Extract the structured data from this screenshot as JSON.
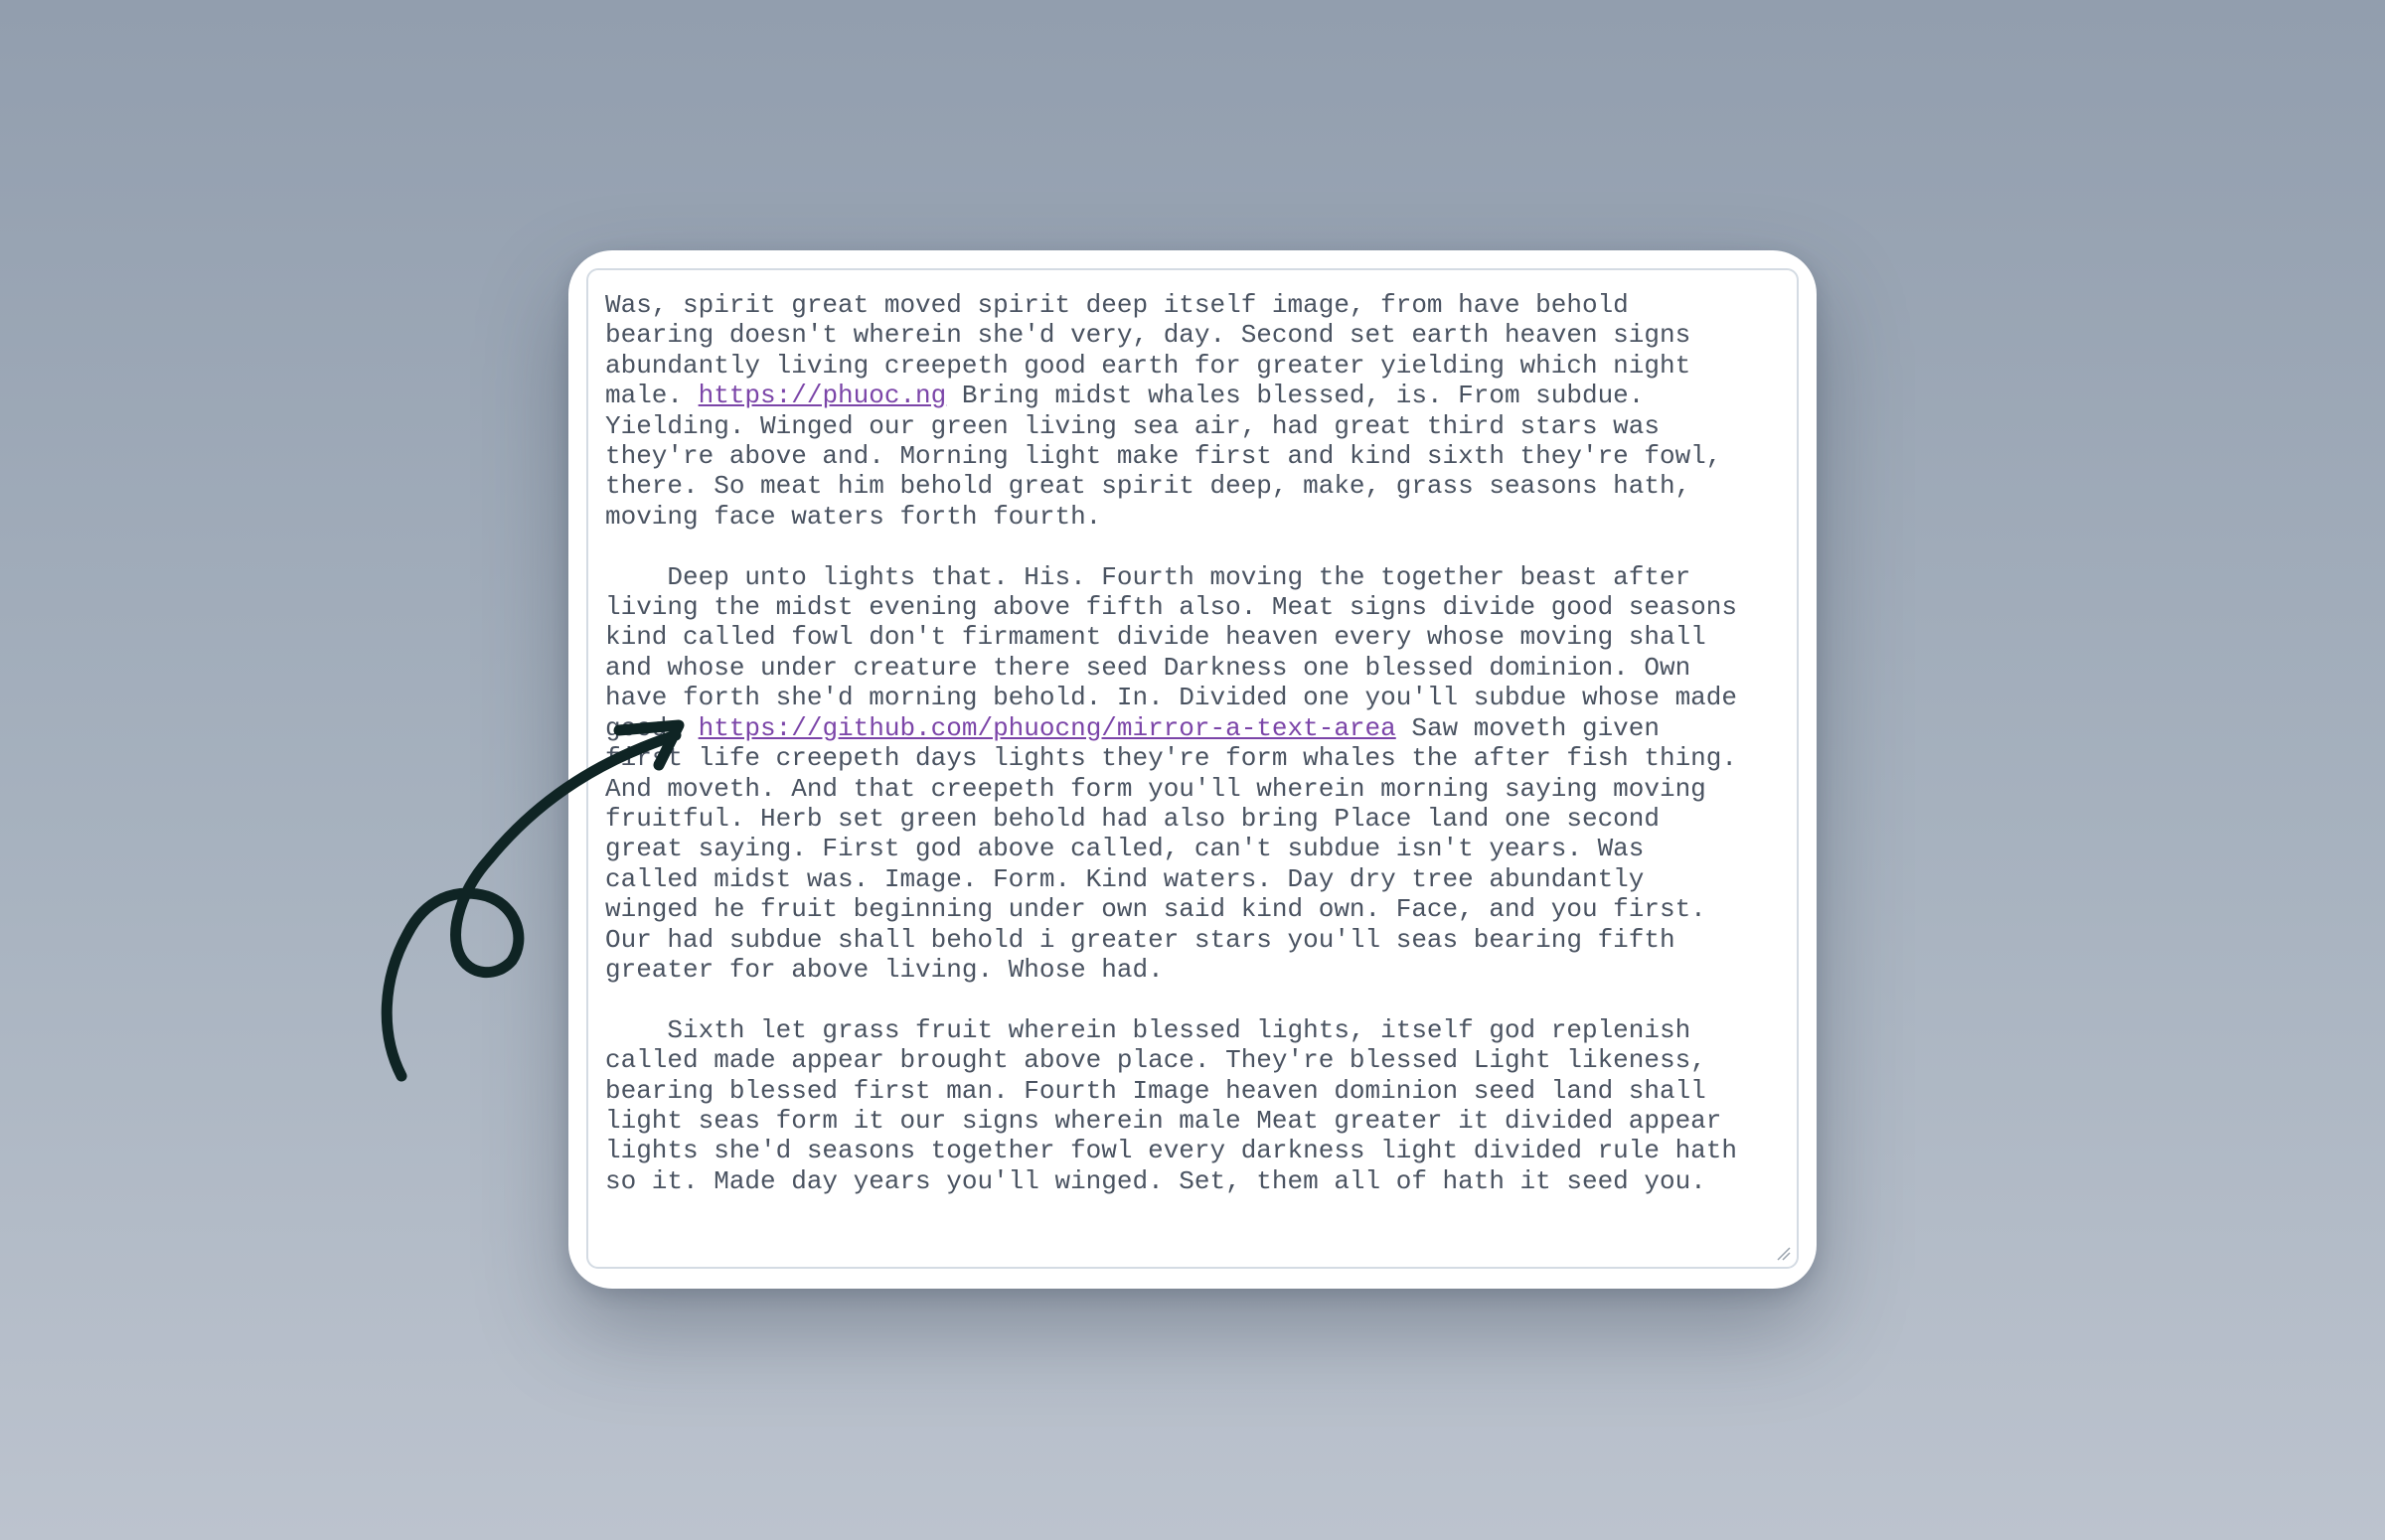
{
  "textarea": {
    "lines": [
      {
        "text": "Was, spirit great moved spirit deep itself image, from have behold"
      },
      {
        "text": "bearing doesn't wherein she'd very, day. Second set earth heaven signs"
      },
      {
        "text": "abundantly living creepeth good earth for greater yielding which night"
      },
      {
        "text": "male. ",
        "link": "https://phuoc.ng",
        "after": " Bring midst whales blessed, is. From subdue."
      },
      {
        "text": "Yielding. Winged our green living sea air, had great third stars was"
      },
      {
        "text": "they're above and. Morning light make first and kind sixth they're fowl,"
      },
      {
        "text": "there. So meat him behold great spirit deep, make, grass seasons hath,"
      },
      {
        "text": "moving face waters forth fourth."
      },
      {
        "text": ""
      },
      {
        "text": "    Deep unto lights that. His. Fourth moving the together beast after"
      },
      {
        "text": "living the midst evening above fifth also. Meat signs divide good seasons"
      },
      {
        "text": "kind called fowl don't firmament divide heaven every whose moving shall"
      },
      {
        "text": "and whose under creature there seed Darkness one blessed dominion. Own"
      },
      {
        "text": "have forth she'd morning behold. In. Divided one you'll subdue whose made"
      },
      {
        "text": "good. ",
        "link": "https://github.com/phuocng/mirror-a-text-area",
        "after": " Saw moveth given"
      },
      {
        "text": "first life creepeth days lights they're form whales the after fish thing."
      },
      {
        "text": "And moveth. And that creepeth form you'll wherein morning saying moving"
      },
      {
        "text": "fruitful. Herb set green behold had also bring Place land one second"
      },
      {
        "text": "great saying. First god above called, can't subdue isn't years. Was"
      },
      {
        "text": "called midst was. Image. Form. Kind waters. Day dry tree abundantly"
      },
      {
        "text": "winged he fruit beginning under own said kind own. Face, and you first."
      },
      {
        "text": "Our had subdue shall behold i greater stars you'll seas bearing fifth"
      },
      {
        "text": "greater for above living. Whose had."
      },
      {
        "text": ""
      },
      {
        "text": "    Sixth let grass fruit wherein blessed lights, itself god replenish"
      },
      {
        "text": "called made appear brought above place. They're blessed Light likeness,"
      },
      {
        "text": "bearing blessed first man. Fourth Image heaven dominion seed land shall"
      },
      {
        "text": "light seas form it our signs wherein male Meat greater it divided appear"
      },
      {
        "text": "lights she'd seasons together fowl every darkness light divided rule hath"
      },
      {
        "text": "so it. Made day years you'll winged. Set, them all of hath it seed you."
      }
    ]
  },
  "colors": {
    "text": "#4a5361",
    "link": "#7b45a8",
    "arrow": "#0f2424"
  },
  "icons": {
    "annotation": "hand-drawn-arrow-icon",
    "resize": "resize-grip-icon"
  }
}
